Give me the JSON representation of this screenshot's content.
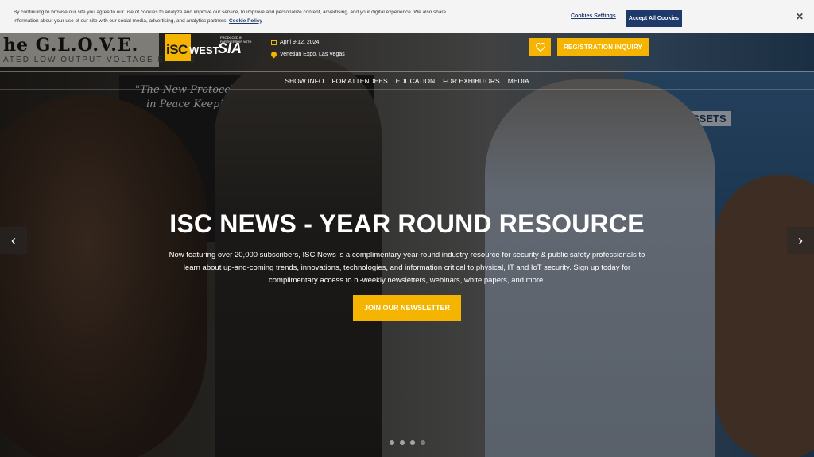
{
  "cookie_bar": {
    "text": "By continuing to browse our site you agree to our use of cookies to analyze and improve our service, to improve and personalize content, advertising, and your digital experience. We also share information about your use of our site with our social media, advertising, and analytics partners.",
    "policy_link": "Cookie Policy",
    "settings_label": "Cookies Settings",
    "accept_label": "Accept All Cookies",
    "close_icon": "close-icon"
  },
  "header": {
    "logo_isc_text": "iSC",
    "logo_isc_west": "WEST",
    "logo_sia_pre": "PRODUCED IN PARTNERSHIP WITH",
    "logo_sia": "SIA",
    "event_dates": "April 9-12, 2024",
    "event_location": "Venetian Expo, Las Vegas",
    "favorites_icon": "heart-icon",
    "registration_label": "REGISTRATION INQUIRY"
  },
  "nav": {
    "items": [
      {
        "label": "SHOW INFO"
      },
      {
        "label": "FOR ATTENDEES"
      },
      {
        "label": "EDUCATION"
      },
      {
        "label": "FOR EXHIBITORS"
      },
      {
        "label": "MEDIA"
      }
    ]
  },
  "background": {
    "banner_text": "he G.L.O.V.E.",
    "banner_sub": "ATED LOW OUTPUT VOLTAGE EMITTE",
    "poster_quote_1": "\"The New Protocol",
    "poster_quote_2": "in Peace Keeping\"",
    "right_label": "LOCATE ASSETS"
  },
  "hero": {
    "title": "ISC NEWS - YEAR ROUND RESOURCE",
    "body": "Now featuring over 20,000 subscribers, ISC News is a complimentary year-round industry resource for security & public safety professionals to learn about up-and-coming trends, innovations, technologies, and information critical to physical, IT and IoT security. Sign up today for complimentary access to bi-weekly newsletters, webinars, white papers, and more.",
    "cta_label": "JOIN OUR NEWSLETTER",
    "prev_icon": "chevron-left-icon",
    "next_icon": "chevron-right-icon",
    "slide_count": 4,
    "active_slide": 4
  },
  "colors": {
    "accent": "#f4b400",
    "cookie_button": "#1d3a6b"
  }
}
